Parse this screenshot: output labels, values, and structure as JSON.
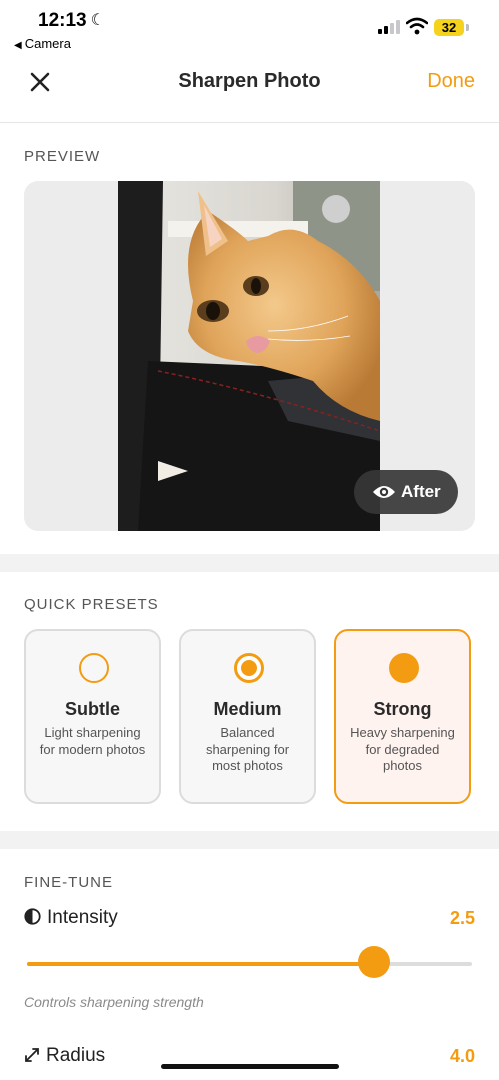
{
  "status": {
    "time": "12:13",
    "back_app": "Camera",
    "battery": "32"
  },
  "nav": {
    "title": "Sharpen Photo",
    "done_label": "Done"
  },
  "preview": {
    "section_label": "PREVIEW",
    "toggle_label": "After",
    "toggle_icon": "eye-icon"
  },
  "presets": {
    "section_label": "QUICK PRESETS",
    "items": [
      {
        "name": "Subtle",
        "desc": "Light sharpening for modern photos",
        "selected": false
      },
      {
        "name": "Medium",
        "desc": "Balanced sharpening for most photos",
        "selected": false
      },
      {
        "name": "Strong",
        "desc": "Heavy sharpening for degraded photos",
        "selected": true
      }
    ]
  },
  "finetune": {
    "section_label": "FINE-TUNE",
    "intensity": {
      "label": "Intensity",
      "value": "2.5",
      "fraction": 0.78,
      "hint": "Controls sharpening strength",
      "icon": "contrast-icon"
    },
    "radius": {
      "label": "Radius",
      "value": "4.0",
      "icon": "resize-icon"
    }
  },
  "colors": {
    "accent": "#f39c12",
    "selected_bg": "#fff3f0",
    "card_bg": "#f7f7f7"
  }
}
